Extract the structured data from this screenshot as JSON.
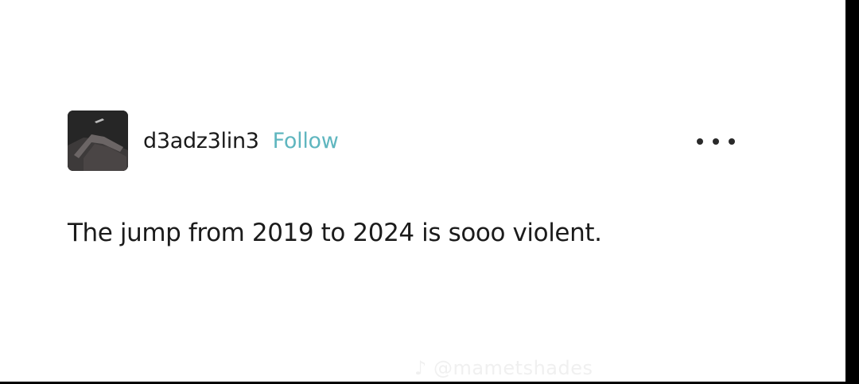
{
  "post": {
    "username": "d3adz3lin3",
    "follow_label": "Follow",
    "text": "The jump from 2019 to 2024 is sooo violent.",
    "more_icon": "more-horizontal-icon"
  },
  "watermark": {
    "text": "♪ @mametshades"
  },
  "colors": {
    "background": "#ffffff",
    "follow_accent": "#5fb6bf",
    "text": "#1b1b1b",
    "border": "#000000"
  }
}
